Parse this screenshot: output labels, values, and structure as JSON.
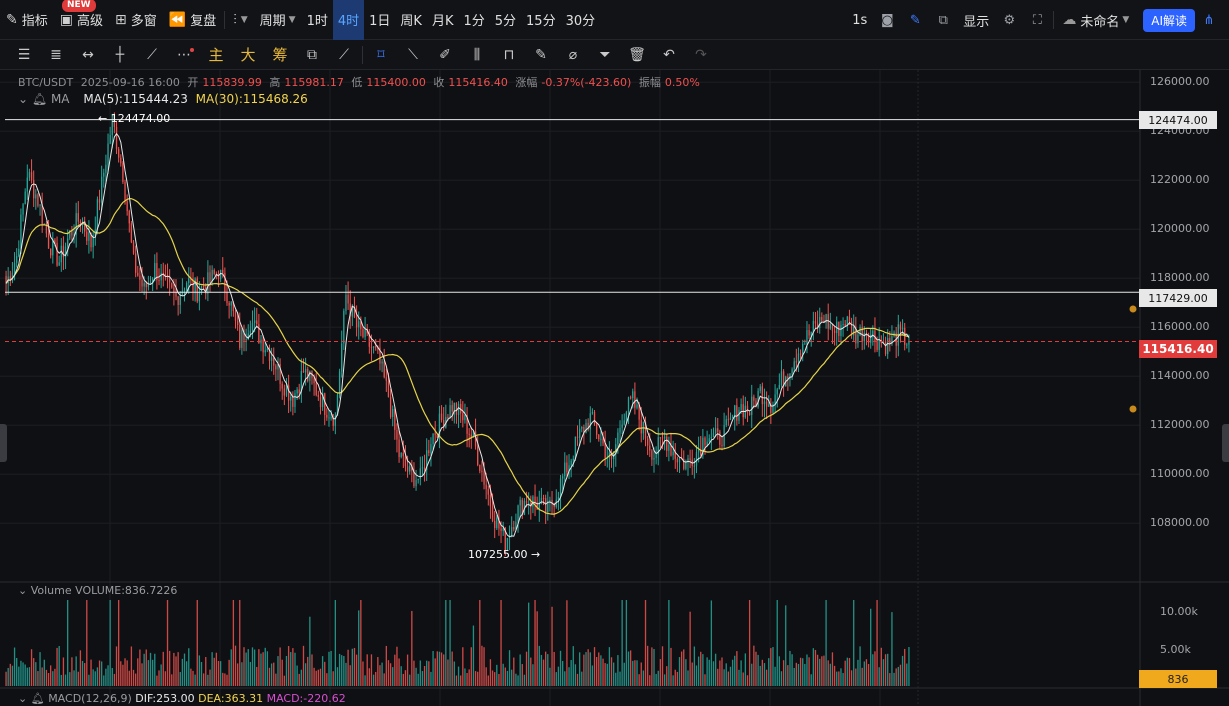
{
  "toolbar": {
    "new_badge": "NEW",
    "indicators": "指标",
    "advanced": "高级",
    "multi_window": "多窗",
    "replay": "复盘",
    "period_label": "周期",
    "periods": [
      "1时",
      "4时",
      "1日",
      "周K",
      "月K",
      "1分",
      "5分",
      "15分",
      "30分"
    ],
    "active_period": "4时",
    "interval": "1s",
    "display": "显示",
    "layout_name": "未命名",
    "ai_button": "AI解读"
  },
  "drawing_tools": {
    "main": "主",
    "big": "大",
    "chips": "筹"
  },
  "header": {
    "symbol": "BTC/USDT",
    "datetime": "2025-09-16 16:00",
    "open_label": "开",
    "open": "115839.99",
    "high_label": "高",
    "high": "115981.17",
    "low_label": "低",
    "low": "115400.00",
    "close_label": "收",
    "close": "115416.40",
    "change_label": "涨幅",
    "change": "-0.37%(-423.60)",
    "amplitude_label": "振幅",
    "amplitude": "0.50%"
  },
  "ma": {
    "label": "MA",
    "ma5": "MA(5):115444.23",
    "ma30": "MA(30):115468.26"
  },
  "volume": {
    "label": "Volume",
    "value": "VOLUME:836.7226",
    "last": "836",
    "axis": [
      "10.00k",
      "5.00k"
    ]
  },
  "macd": {
    "label": "MACD(12,26,9)",
    "dif": "DIF:253.00",
    "dea": "DEA:363.31",
    "macd": "MACD:-220.62"
  },
  "price_axis": [
    "126000.00",
    "124000.00",
    "122000.00",
    "120000.00",
    "118000.00",
    "116000.00",
    "114000.00",
    "112000.00",
    "110000.00",
    "108000.00"
  ],
  "horizontal_lines": [
    "124474.00",
    "117429.00"
  ],
  "last_price": "115416.40",
  "annotations": {
    "high_mark": "124474.00",
    "low_mark": "107255.00"
  },
  "colors": {
    "up": "#26a69a",
    "down": "#ef5350",
    "ma5": "#e9e9e9",
    "ma30": "#e6d44a",
    "accent": "#2c62ff"
  },
  "chart_data": {
    "type": "candlestick",
    "pair": "BTC/USDT",
    "timeframe": "4时",
    "ylim": [
      106500,
      126500
    ],
    "close_path": [
      117800,
      118900,
      122300,
      121200,
      119500,
      118700,
      119800,
      120500,
      119400,
      121800,
      124474,
      122300,
      118600,
      117500,
      118400,
      117700,
      117200,
      117900,
      117500,
      117800,
      118300,
      117200,
      115400,
      116300,
      115500,
      114900,
      113800,
      113100,
      114200,
      113600,
      112800,
      112300,
      117300,
      116000,
      115400,
      114800,
      113200,
      110800,
      110000,
      109800,
      111500,
      112200,
      112800,
      112300,
      111400,
      109800,
      108200,
      107255,
      108400,
      109000,
      108800,
      108500,
      109400,
      110500,
      111600,
      112300,
      111400,
      110400,
      112400,
      113000,
      111800,
      110800,
      111500,
      110800,
      110400,
      110900,
      111700,
      111400,
      111900,
      112800,
      112600,
      113400,
      112900,
      113800,
      114600,
      115400,
      115900,
      116400,
      115800,
      116300,
      115700,
      115900,
      115500,
      115300,
      115700,
      115416
    ]
  }
}
